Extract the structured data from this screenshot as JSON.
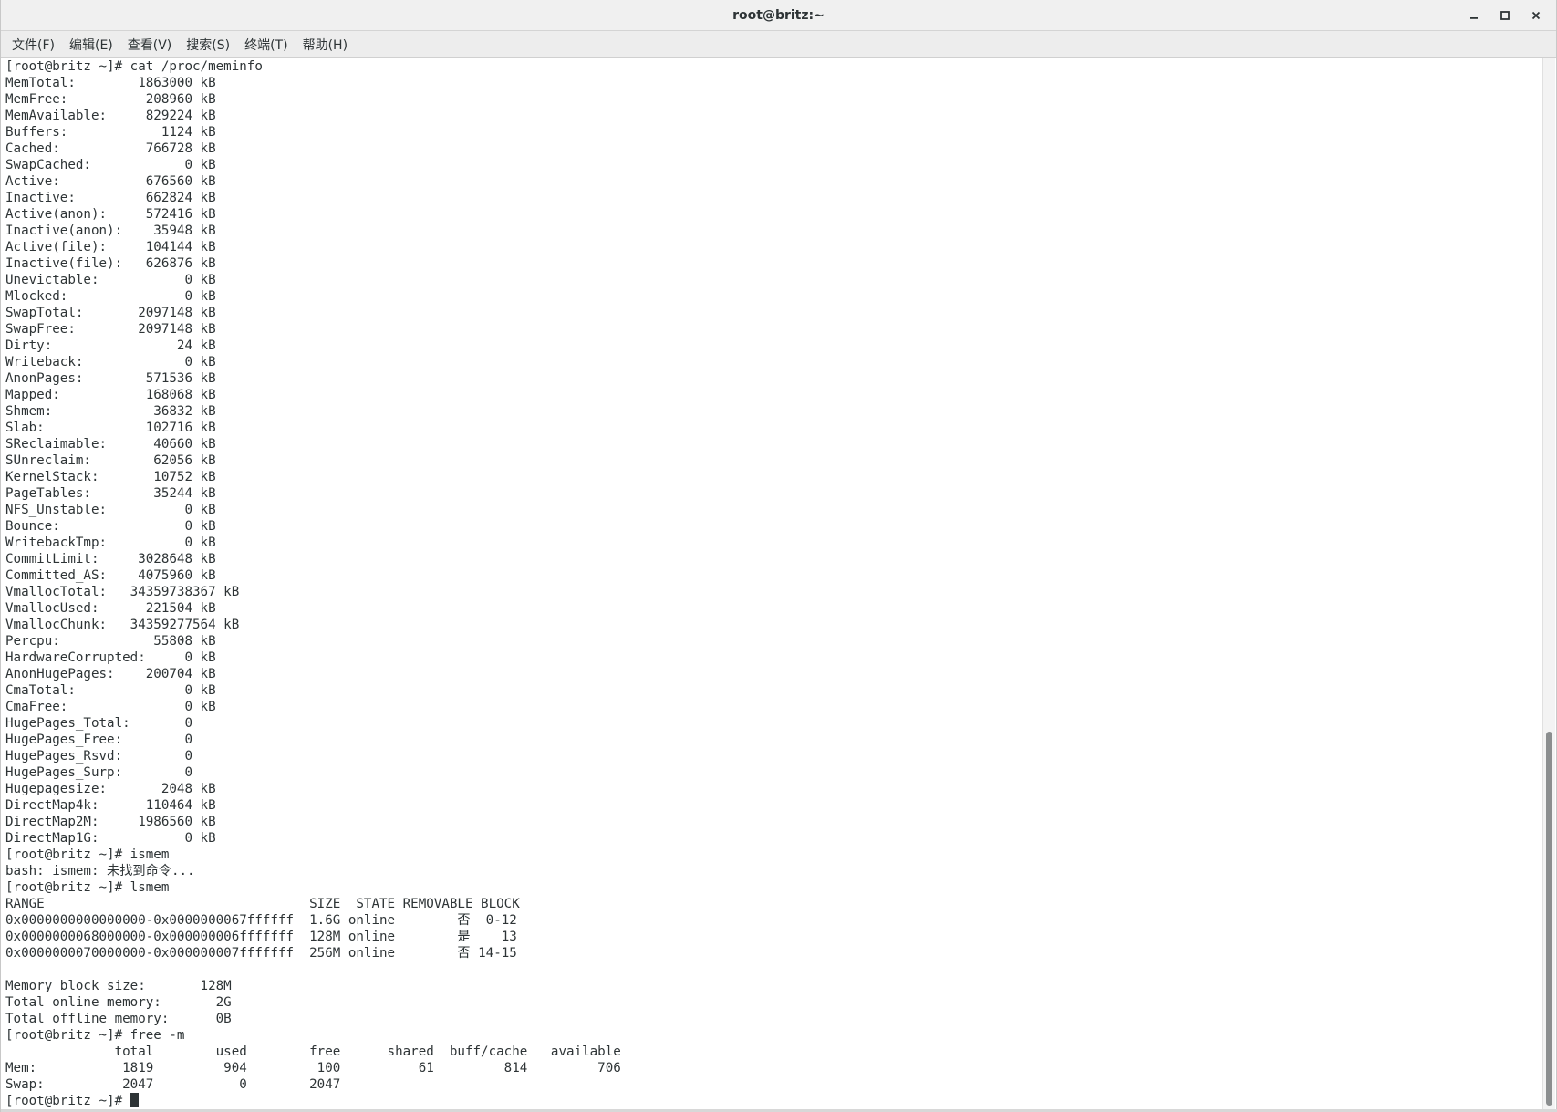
{
  "window": {
    "title": "root@britz:~"
  },
  "menubar": {
    "items": [
      "文件(F)",
      "编辑(E)",
      "查看(V)",
      "搜索(S)",
      "终端(T)",
      "帮助(H)"
    ]
  },
  "icons": {
    "minimize": "minimize-icon",
    "maximize": "maximize-icon",
    "close": "close-icon"
  },
  "colors": {
    "text": "#2e3436",
    "background": "#ffffff",
    "scroll_thumb": "#8b8e8f"
  },
  "terminal": {
    "lines": [
      "[root@britz ~]# cat /proc/meminfo",
      "MemTotal:        1863000 kB",
      "MemFree:          208960 kB",
      "MemAvailable:     829224 kB",
      "Buffers:            1124 kB",
      "Cached:           766728 kB",
      "SwapCached:            0 kB",
      "Active:           676560 kB",
      "Inactive:         662824 kB",
      "Active(anon):     572416 kB",
      "Inactive(anon):    35948 kB",
      "Active(file):     104144 kB",
      "Inactive(file):   626876 kB",
      "Unevictable:           0 kB",
      "Mlocked:               0 kB",
      "SwapTotal:       2097148 kB",
      "SwapFree:        2097148 kB",
      "Dirty:                24 kB",
      "Writeback:             0 kB",
      "AnonPages:        571536 kB",
      "Mapped:           168068 kB",
      "Shmem:             36832 kB",
      "Slab:             102716 kB",
      "SReclaimable:      40660 kB",
      "SUnreclaim:        62056 kB",
      "KernelStack:       10752 kB",
      "PageTables:        35244 kB",
      "NFS_Unstable:          0 kB",
      "Bounce:                0 kB",
      "WritebackTmp:          0 kB",
      "CommitLimit:     3028648 kB",
      "Committed_AS:    4075960 kB",
      "VmallocTotal:   34359738367 kB",
      "VmallocUsed:      221504 kB",
      "VmallocChunk:   34359277564 kB",
      "Percpu:            55808 kB",
      "HardwareCorrupted:     0 kB",
      "AnonHugePages:    200704 kB",
      "CmaTotal:              0 kB",
      "CmaFree:               0 kB",
      "HugePages_Total:       0",
      "HugePages_Free:        0",
      "HugePages_Rsvd:        0",
      "HugePages_Surp:        0",
      "Hugepagesize:       2048 kB",
      "DirectMap4k:      110464 kB",
      "DirectMap2M:     1986560 kB",
      "DirectMap1G:           0 kB",
      "[root@britz ~]# ismem",
      "bash: ismem: 未找到命令...",
      "[root@britz ~]# lsmem",
      "RANGE                                  SIZE  STATE REMOVABLE BLOCK",
      "0x0000000000000000-0x0000000067ffffff  1.6G online        否  0-12",
      "0x0000000068000000-0x000000006fffffff  128M online        是    13",
      "0x0000000070000000-0x000000007fffffff  256M online        否 14-15",
      "",
      "Memory block size:       128M",
      "Total online memory:       2G",
      "Total offline memory:      0B",
      "[root@britz ~]# free -m",
      "              total        used        free      shared  buff/cache   available",
      "Mem:           1819         904         100          61         814         706",
      "Swap:          2047           0        2047"
    ],
    "prompt": "[root@britz ~]# "
  }
}
